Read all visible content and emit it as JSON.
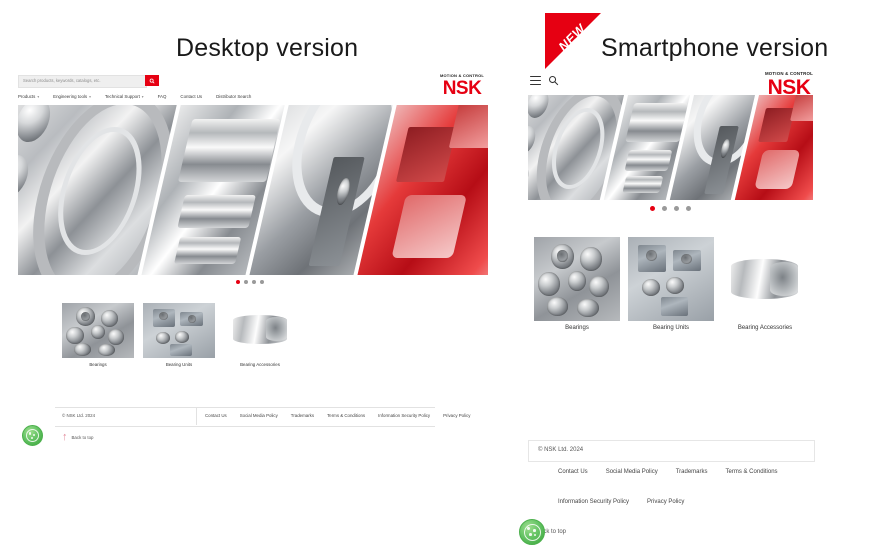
{
  "labels": {
    "desktop_title": "Desktop version",
    "smartphone_title": "Smartphone version",
    "new_badge": "NEW"
  },
  "brand": {
    "tagline": "MOTION & CONTROL",
    "name": "NSK",
    "accent_red": "#e60012",
    "cookie_green": "#4cb04c"
  },
  "desktop": {
    "search": {
      "placeholder": "Search products, keywords, catalogs, etc.",
      "value": "",
      "button_icon": "search-icon"
    },
    "nav": [
      {
        "label": "Products",
        "has_dropdown": true
      },
      {
        "label": "Engineering tools",
        "has_dropdown": true
      },
      {
        "label": "Technical Support",
        "has_dropdown": true
      },
      {
        "label": "FAQ",
        "has_dropdown": false
      },
      {
        "label": "Contact Us",
        "has_dropdown": false
      },
      {
        "label": "Distributor Search",
        "has_dropdown": false
      }
    ],
    "carousel": {
      "total": 4,
      "active_index": 0
    },
    "products": [
      {
        "label": "Bearings"
      },
      {
        "label": "Bearing Units"
      },
      {
        "label": "Bearing Accessories"
      }
    ],
    "footer": {
      "copyright": "© NSK Ltd. 2024",
      "links": [
        "Contact Us",
        "Social Media Policy",
        "Trademarks",
        "Terms & Conditions",
        "Information Security Policy",
        "Privacy Policy"
      ],
      "back_to_top": "Back to top"
    }
  },
  "smartphone": {
    "header": {
      "menu_icon": "hamburger-menu-icon",
      "search_icon": "search-icon"
    },
    "carousel": {
      "total": 4,
      "active_index": 0
    },
    "products": [
      {
        "label": "Bearings"
      },
      {
        "label": "Bearing Units"
      },
      {
        "label": "Bearing Accessories"
      }
    ],
    "footer": {
      "copyright": "© NSK Ltd. 2024",
      "links_row1": [
        "Contact Us",
        "Social Media Policy",
        "Trademarks",
        "Terms & Conditions"
      ],
      "links_row2": [
        "Information Security Policy",
        "Privacy Policy"
      ],
      "back_to_top": "Back to top"
    }
  }
}
